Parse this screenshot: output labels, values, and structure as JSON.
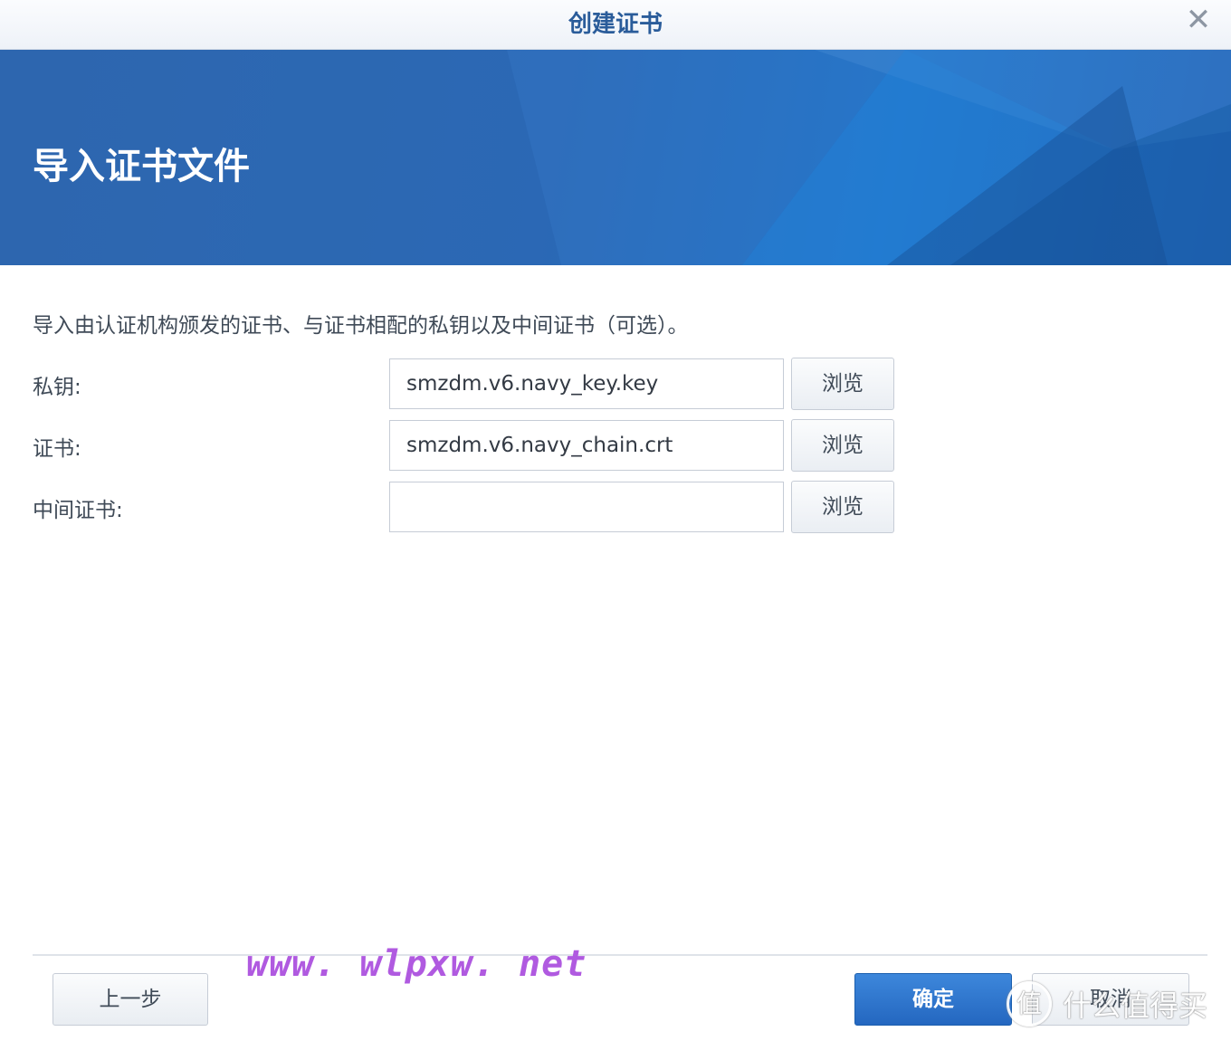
{
  "window": {
    "title": "创建证书"
  },
  "banner": {
    "title": "导入证书文件"
  },
  "description": "导入由认证机构颁发的证书、与证书相配的私钥以及中间证书（可选）。",
  "fields": [
    {
      "label": "私钥:",
      "value": "smzdm.v6.navy_key.key",
      "browse_label": "浏览"
    },
    {
      "label": "证书:",
      "value": "smzdm.v6.navy_chain.crt",
      "browse_label": "浏览"
    },
    {
      "label": "中间证书:",
      "value": "",
      "browse_label": "浏览"
    }
  ],
  "footer": {
    "prev_label": "上一步",
    "ok_label": "确定",
    "cancel_label": "取消"
  },
  "watermark": "www. wlpxw. net",
  "brand": {
    "badge": "值",
    "text": "什么值得买"
  },
  "colors": {
    "accent": "#2a69b8",
    "primary_button": "#2f74cf",
    "title": "#2a5c9a"
  },
  "icons": {
    "close": "close-icon"
  }
}
